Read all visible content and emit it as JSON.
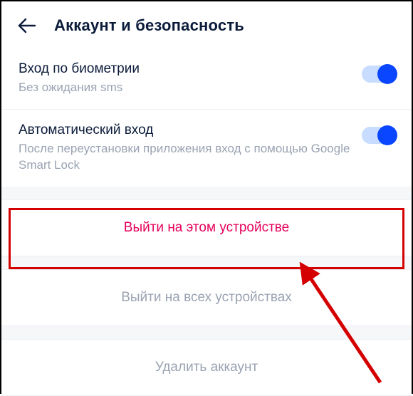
{
  "header": {
    "title": "Аккаунт и безопасность"
  },
  "settings": [
    {
      "title": "Вход по биометрии",
      "subtitle": "Без ожидания sms",
      "enabled": true
    },
    {
      "title": "Автоматический вход",
      "subtitle": "После переустановки приложения вход с помощью Google Smart Lock",
      "enabled": true
    }
  ],
  "actions": {
    "logout_this": "Выйти на этом устройстве",
    "logout_all": "Выйти на всех устройствах",
    "delete": "Удалить аккаунт"
  },
  "colors": {
    "accent": "#0a46ff",
    "danger": "#e5005a",
    "highlight": "#d40000"
  }
}
